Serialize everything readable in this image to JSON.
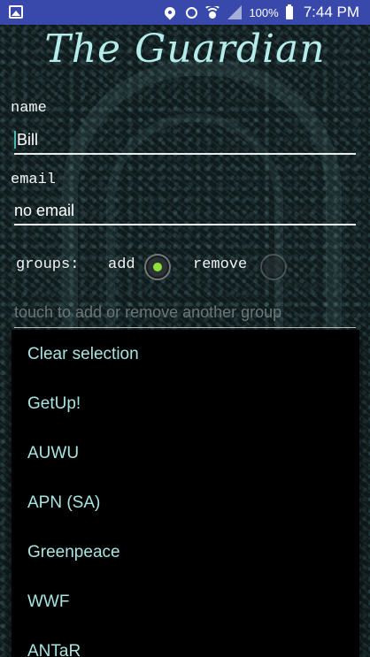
{
  "status_bar": {
    "battery": "100%",
    "time": "7:44 PM",
    "icons": [
      "image-icon",
      "location-icon",
      "alarm-icon",
      "wifi-icon",
      "signal-icon",
      "battery-icon"
    ]
  },
  "app": {
    "title": "The Guardian"
  },
  "form": {
    "name_label": "name",
    "name_value": "Bill",
    "email_label": "email",
    "email_value": "no email",
    "groups_label": "groups:",
    "add_label": "add",
    "remove_label": "remove",
    "selected_mode": "add",
    "group_placeholder": "touch to add or remove another group"
  },
  "dropdown": {
    "items": [
      {
        "label": "Clear selection"
      },
      {
        "label": "GetUp!"
      },
      {
        "label": "AUWU"
      },
      {
        "label": "APN (SA)"
      },
      {
        "label": "Greenpeace"
      },
      {
        "label": "WWF"
      },
      {
        "label": "ANTaR"
      }
    ]
  },
  "colors": {
    "status_bar": "#3949ab",
    "title": "#b3ecea",
    "dropdown_text": "#a7e5e3",
    "radio_selected": "#8ee03a"
  }
}
